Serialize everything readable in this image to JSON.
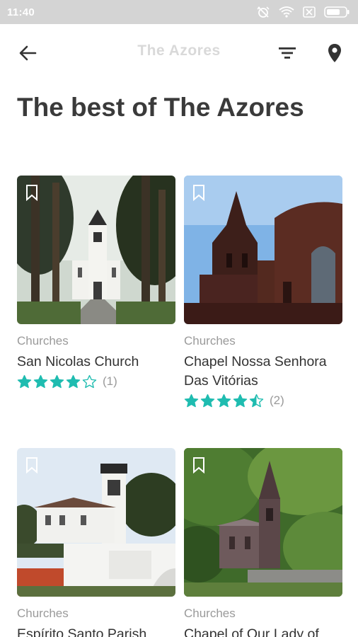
{
  "status_bar": {
    "time": "11:40",
    "icons": [
      "alarm-off-icon",
      "wifi-icon",
      "sim-x-icon",
      "battery-icon"
    ]
  },
  "app_bar": {
    "title": "The Azores",
    "back_icon": "arrow-back-icon",
    "filter_icon": "filter-icon",
    "map_icon": "location-pin-icon"
  },
  "page": {
    "heading": "The best of The Azores"
  },
  "accent_color": "#1fbcb0",
  "cards": [
    {
      "category": "Churches",
      "name": "San Nicolas Church",
      "rating": 4,
      "rating_count": "(1)"
    },
    {
      "category": "Churches",
      "name": "Chapel Nossa Senhora Das Vitórias",
      "rating": 4.5,
      "rating_count": "(2)"
    },
    {
      "category": "Churches",
      "name": "Espírito Santo Parish"
    },
    {
      "category": "Churches",
      "name": "Chapel of Our Lady of"
    }
  ]
}
